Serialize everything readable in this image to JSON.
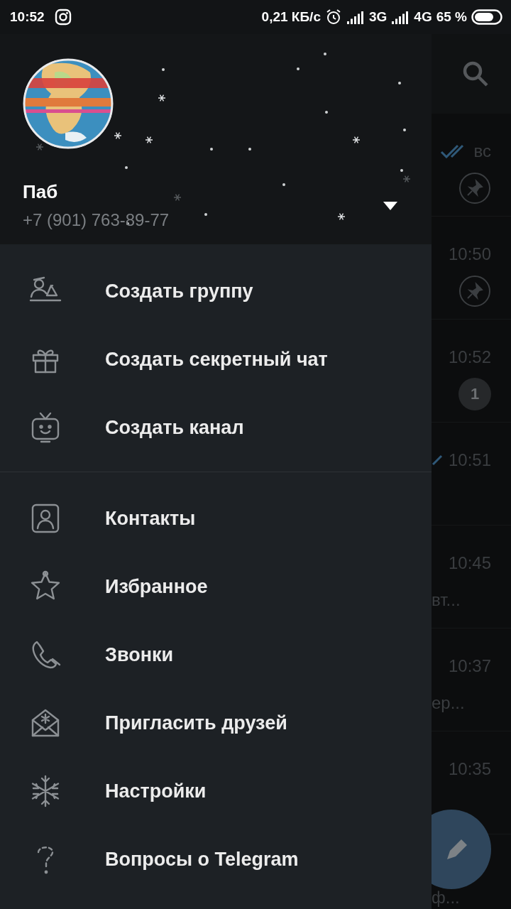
{
  "status_bar": {
    "time": "10:52",
    "network_speed": "0,21 КБ/с",
    "networks": [
      "3G",
      "4G"
    ],
    "battery": "65 %"
  },
  "drawer": {
    "user": {
      "name": "Паб",
      "phone": "+7 (901) 763-89-77"
    },
    "groups": [
      [
        {
          "label": "Создать группу"
        },
        {
          "label": "Создать секретный чат"
        },
        {
          "label": "Создать канал"
        }
      ],
      [
        {
          "label": "Контакты"
        },
        {
          "label": "Избранное"
        },
        {
          "label": "Звонки"
        },
        {
          "label": "Пригласить друзей"
        },
        {
          "label": "Настройки"
        },
        {
          "label": "Вопросы о Telegram"
        }
      ]
    ]
  },
  "chat_list": [
    {
      "time": "вс",
      "sent": true,
      "read": true,
      "pinned": true
    },
    {
      "time": "10:50",
      "sent": false,
      "pinned": true
    },
    {
      "time": "10:52",
      "sent": false,
      "pinned": false,
      "unread": "1"
    },
    {
      "time": "10:51",
      "sent": true,
      "read": false,
      "pinned": false
    },
    {
      "time": "10:45",
      "sent": false,
      "pinned": false,
      "preview": "вт..."
    },
    {
      "time": "10:37",
      "sent": false,
      "pinned": false,
      "preview": "ер..."
    },
    {
      "time": "10:35",
      "sent": false,
      "pinned": false
    },
    {
      "sent": false,
      "pinned": false,
      "preview": "ф..."
    }
  ]
}
